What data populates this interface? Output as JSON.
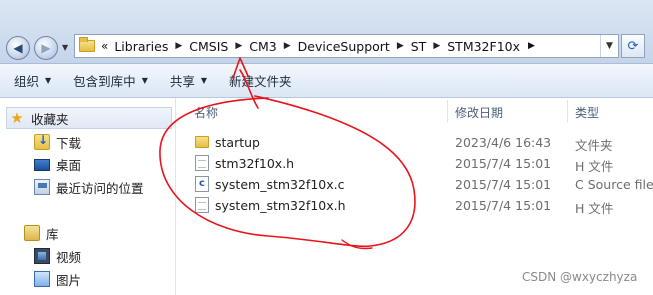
{
  "address": {
    "overflow_marker": "«",
    "crumbs": [
      "Libraries",
      "CMSIS",
      "CM3",
      "DeviceSupport",
      "ST",
      "STM32F10x"
    ]
  },
  "toolbar": {
    "organize": "组织",
    "include_in_library": "包含到库中",
    "share": "共享",
    "new_folder": "新建文件夹"
  },
  "sidebar": {
    "favorites": "收藏夹",
    "downloads": "下载",
    "desktop": "桌面",
    "recent": "最近访问的位置",
    "libraries": "库",
    "videos": "视频",
    "pictures": "图片"
  },
  "columns": {
    "name": "名称",
    "date": "修改日期",
    "type": "类型"
  },
  "files": [
    {
      "name": "startup",
      "date": "2023/4/6 16:43",
      "type": "文件夹",
      "icon": "folder-icon"
    },
    {
      "name": "stm32f10x.h",
      "date": "2015/7/4 15:01",
      "type": "H 文件",
      "icon": "header-file-icon"
    },
    {
      "name": "system_stm32f10x.c",
      "date": "2015/7/4 15:01",
      "type": "C Source file",
      "icon": "c-source-file-icon"
    },
    {
      "name": "system_stm32f10x.h",
      "date": "2015/7/4 15:01",
      "type": "H 文件",
      "icon": "header-file-icon"
    }
  ],
  "annotation_color": "#e8141a",
  "watermark": "CSDN @wxyczhyza"
}
